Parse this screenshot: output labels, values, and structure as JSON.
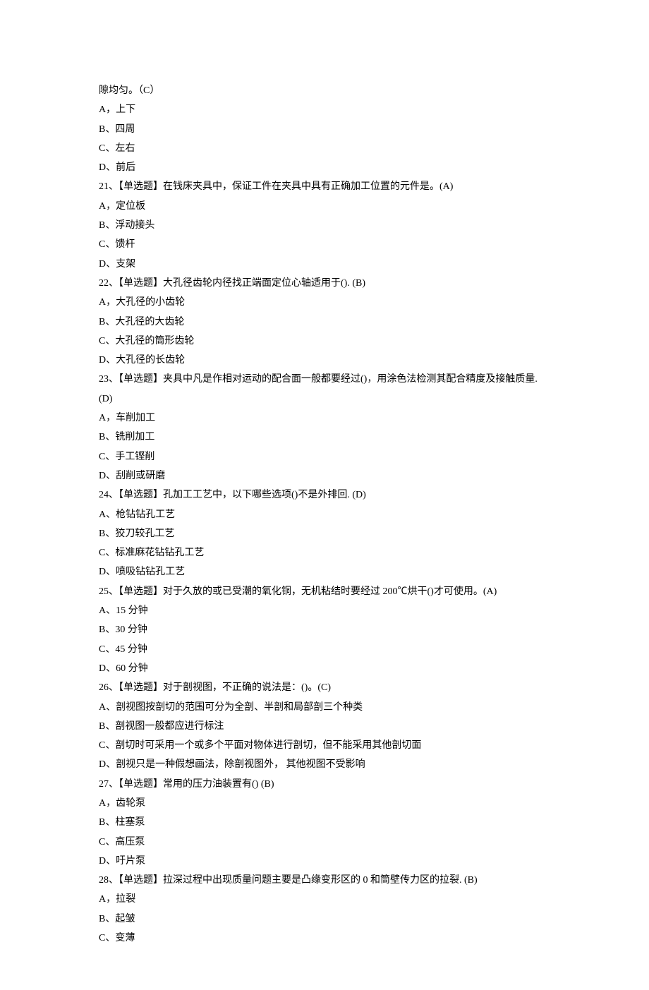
{
  "lines": [
    "隙均匀。（C）",
    "A，上下",
    "B、四周",
    "C、左右",
    "D、前后",
    "21、【单选题】在钱床夹具中，保证工件在夹具中具有正确加工位置的元件是。(A)",
    "A，定位板",
    "B、浮动接头",
    "C、馈杆",
    "D、支架",
    "22、【单选题】大孔径齿轮内径找正端面定位心轴适用于(). (B)",
    "A，大孔径的小齿轮",
    "B、大孔径的大齿轮",
    "C、大孔径的筒形齿轮",
    "D、大孔径的长齿轮",
    "23、【单选题】夹具中凡是作相对运动的配合面一般都要经过()，用涂色法检测其配合精度及接触质量. (D)",
    "A，车削加工",
    "B、铣削加工",
    "C、手工铿削",
    "D、刮削或研磨",
    "24、【单选题】孔加工工艺中，以下哪些选项()不是外排回. (D)",
    "A、枪钻钻孔工艺",
    "B、狡刀较孔工艺",
    "C、标准麻花钻钻孔工艺",
    "D、喷吸钻钻孔工艺",
    "25、【单选题】对于久放的或已受潮的氧化铜，无机粘结时要经过 200℃烘干()才可使用。(A)",
    "A、15 分钟",
    "B、30 分钟",
    "C、45 分钟",
    "D、60 分钟",
    "26、【单选题】对于剖视图，不正确的说法是：()。(C)",
    "A、剖视图按剖切的范围可分为全剖、半剖和局部剖三个种类",
    "B、剖视图一般都应进行标注",
    "C、剖切时可采用一个或多个平面对物体进行剖切，但不能采用其他剖切面",
    "D、剖视只是一种假想画法，除剖视图外， 其他视图不受影响",
    "27、【单选题】常用的压力油装置有() (B)",
    "A，齿轮泵",
    "B、柱塞泵",
    "C、高压泵",
    "D、吁片泵",
    "28、【单选题】拉深过程中出现质量问题主要是凸缘变形区的 0 和筒壁传力区的拉裂. (B)",
    "A，拉裂",
    "B、起皱",
    "C、变薄"
  ]
}
